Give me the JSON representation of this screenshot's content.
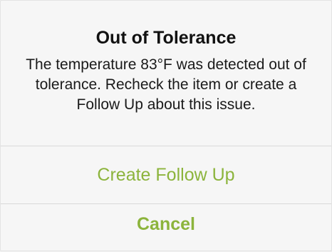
{
  "alert": {
    "title": "Out of Tolerance",
    "message": "The temperature 83°F was detected out of tolerance. Recheck the item or create a Follow Up about this issue.",
    "actions": [
      {
        "label": "Create Follow Up",
        "color": "#8cb43c"
      },
      {
        "label": "Cancel",
        "color": "#8cb43c"
      }
    ]
  },
  "colors": {
    "accent": "#8cb43c",
    "background": "#f6f6f6",
    "divider": "#d9d9d9"
  }
}
